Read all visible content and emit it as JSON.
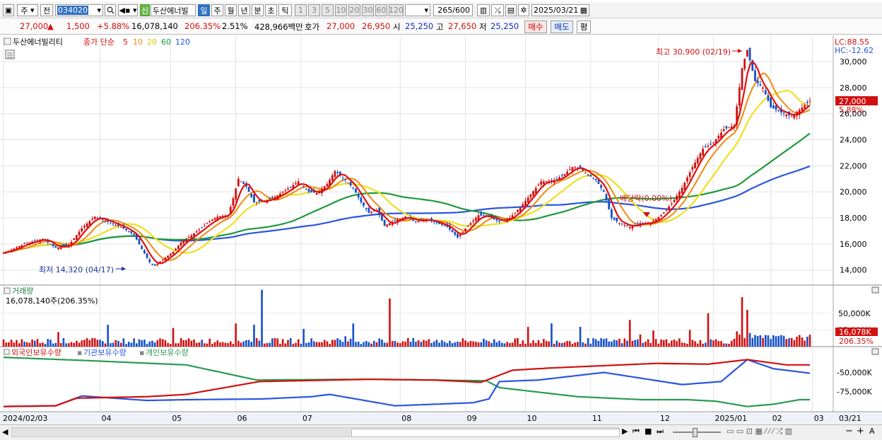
{
  "toolbar": {
    "market": "주",
    "prev": "전",
    "code": "034020",
    "badge_new": "신",
    "stock_name": "두산에너빌",
    "periods": [
      "일",
      "주",
      "월",
      "년",
      "분",
      "초",
      "틱"
    ],
    "period_selected": "일",
    "intervals": [
      "1",
      "3",
      "5",
      "10",
      "20",
      "30",
      "60",
      "120"
    ],
    "count": "265",
    "count_total": "/600",
    "date": "2025/03/21"
  },
  "quote": {
    "price": "27,000",
    "change": "1,500",
    "change_pct": "+5.88%",
    "volume": "16,078,140",
    "volume_ratio": "206.35%",
    "turnover": "2.51%",
    "amount": "428,966백만",
    "hoga_label": "호가",
    "ask": "27,000",
    "bid": "26,950",
    "open_label": "시",
    "open": "25,250",
    "high_label": "고",
    "high": "27,650",
    "low_label": "저",
    "low": "25,250",
    "buy": "매수",
    "sell": "매도",
    "avg": "평"
  },
  "colors": {
    "up": "#d21010",
    "down": "#1450c8",
    "ma5": "#e01010",
    "ma10": "#f08a10",
    "ma20": "#f0e020",
    "ma60": "#1f9a3a",
    "ma120": "#2a55e0",
    "foreign": "#d01010",
    "institution": "#2a55e0",
    "individual": "#2a9a50"
  },
  "price_panel": {
    "stock_label": "두산에너빌리티",
    "legend_prefix": "종가 단순",
    "ma_labels": [
      "5",
      "10",
      "20",
      "60",
      "120"
    ],
    "lc_label": "LC:88.55",
    "hc_label": "HC:-12.62",
    "max_label": "최고 30,900 (02/19)",
    "min_label": "최저 14,320 (04/17)",
    "dividend_label": "배당락(0.00%)",
    "last_price_tag": "27,000",
    "last_pct_tag": "5.88%"
  },
  "volume_panel": {
    "title": "거래량",
    "value_label": "16,078,140주(206.35%)",
    "tag_value": "16,078K",
    "tag_pct": "206.35%"
  },
  "holder_panel": {
    "foreign_label": "외국인보유수량",
    "institution_label": "기관보유수량",
    "individual_label": "개인보유수량"
  },
  "chart_data": {
    "type": "candlestick",
    "x_axis_labels": [
      "2024/02/03",
      "04",
      "05",
      "06",
      "07",
      "08",
      "09",
      "10",
      "11",
      "12",
      "2025/01",
      "02",
      "03",
      "03/21"
    ],
    "price_axis": [
      "30,000",
      "28,000",
      "26,000",
      "24,000",
      "22,000",
      "20,000",
      "18,000",
      "16,000",
      "14,000"
    ],
    "price_ylim": [
      13000,
      31800
    ],
    "volume_axis": [
      "50,000K",
      "25,000K"
    ],
    "volume_ylim": [
      0,
      90000
    ],
    "holder_axis": [
      "-50,000K",
      "-75,000K"
    ],
    "price_keys": [
      [
        0,
        15300
      ],
      [
        8,
        16000
      ],
      [
        15,
        16400
      ],
      [
        20,
        15700
      ],
      [
        25,
        15900
      ],
      [
        30,
        17200
      ],
      [
        35,
        18100
      ],
      [
        40,
        17700
      ],
      [
        45,
        17300
      ],
      [
        50,
        16700
      ],
      [
        53,
        15600
      ],
      [
        56,
        14600
      ],
      [
        58,
        14320
      ],
      [
        61,
        14800
      ],
      [
        65,
        15400
      ],
      [
        68,
        16100
      ],
      [
        73,
        16800
      ],
      [
        78,
        17600
      ],
      [
        82,
        18100
      ],
      [
        86,
        18200
      ],
      [
        88,
        19500
      ],
      [
        90,
        21000
      ],
      [
        93,
        20400
      ],
      [
        96,
        19200
      ],
      [
        100,
        19300
      ],
      [
        104,
        19600
      ],
      [
        108,
        20100
      ],
      [
        113,
        20800
      ],
      [
        117,
        20000
      ],
      [
        120,
        19900
      ],
      [
        124,
        20600
      ],
      [
        127,
        21600
      ],
      [
        130,
        21100
      ],
      [
        134,
        20300
      ],
      [
        137,
        19200
      ],
      [
        140,
        18400
      ],
      [
        143,
        18600
      ],
      [
        146,
        17400
      ],
      [
        150,
        17800
      ],
      [
        154,
        18100
      ],
      [
        158,
        17700
      ],
      [
        162,
        17900
      ],
      [
        166,
        17600
      ],
      [
        170,
        17300
      ],
      [
        174,
        16500
      ],
      [
        178,
        17400
      ],
      [
        182,
        18200
      ],
      [
        186,
        18100
      ],
      [
        190,
        17700
      ],
      [
        194,
        18000
      ],
      [
        198,
        18800
      ],
      [
        202,
        19800
      ],
      [
        206,
        20800
      ],
      [
        210,
        20800
      ],
      [
        214,
        21200
      ],
      [
        218,
        21900
      ],
      [
        221,
        21800
      ],
      [
        224,
        21300
      ],
      [
        227,
        20900
      ],
      [
        230,
        20000
      ],
      [
        233,
        18000
      ],
      [
        236,
        17600
      ],
      [
        240,
        17300
      ],
      [
        244,
        17600
      ],
      [
        248,
        17600
      ],
      [
        252,
        18200
      ],
      [
        256,
        19100
      ],
      [
        260,
        20300
      ],
      [
        264,
        21900
      ],
      [
        268,
        23300
      ],
      [
        272,
        23800
      ],
      [
        276,
        24800
      ],
      [
        280,
        25100
      ],
      [
        283,
        29500
      ],
      [
        285,
        30900
      ],
      [
        288,
        28500
      ],
      [
        291,
        28000
      ],
      [
        294,
        26500
      ],
      [
        298,
        26100
      ],
      [
        302,
        25800
      ],
      [
        305,
        26300
      ],
      [
        309,
        27000
      ]
    ],
    "volume_spikes": [
      [
        99,
        85000
      ],
      [
        148,
        72000
      ],
      [
        240,
        40000
      ],
      [
        270,
        50000
      ],
      [
        283,
        74000
      ],
      [
        285,
        55000
      ]
    ],
    "foreign_keys": [
      [
        0,
        -95000
      ],
      [
        20,
        -94000
      ],
      [
        28,
        -84000
      ],
      [
        55,
        -82000
      ],
      [
        70,
        -79000
      ],
      [
        98,
        -62000
      ],
      [
        140,
        -59000
      ],
      [
        165,
        -60000
      ],
      [
        183,
        -63000
      ],
      [
        195,
        -47000
      ],
      [
        210,
        -44000
      ],
      [
        230,
        -41000
      ],
      [
        250,
        -38000
      ],
      [
        270,
        -39000
      ],
      [
        285,
        -33000
      ],
      [
        300,
        -40000
      ],
      [
        309,
        -40000
      ]
    ],
    "institution_keys": [
      [
        0,
        -95000
      ],
      [
        20,
        -94000
      ],
      [
        30,
        -81000
      ],
      [
        55,
        -87000
      ],
      [
        70,
        -86000
      ],
      [
        99,
        -85000
      ],
      [
        118,
        -82000
      ],
      [
        125,
        -79000
      ],
      [
        150,
        -94000
      ],
      [
        180,
        -90000
      ],
      [
        186,
        -85000
      ],
      [
        190,
        -62000
      ],
      [
        205,
        -60000
      ],
      [
        230,
        -50000
      ],
      [
        245,
        -58000
      ],
      [
        260,
        -66000
      ],
      [
        275,
        -62000
      ],
      [
        285,
        -33000
      ],
      [
        295,
        -45000
      ],
      [
        309,
        -51000
      ]
    ],
    "individual_keys": [
      [
        0,
        -30000
      ],
      [
        30,
        -34000
      ],
      [
        70,
        -40000
      ],
      [
        97,
        -60000
      ],
      [
        140,
        -59000
      ],
      [
        185,
        -61000
      ],
      [
        190,
        -70000
      ],
      [
        220,
        -82000
      ],
      [
        245,
        -86000
      ],
      [
        262,
        -86000
      ],
      [
        273,
        -88000
      ],
      [
        285,
        -95000
      ],
      [
        295,
        -92000
      ],
      [
        305,
        -86000
      ],
      [
        309,
        -86000
      ]
    ]
  }
}
